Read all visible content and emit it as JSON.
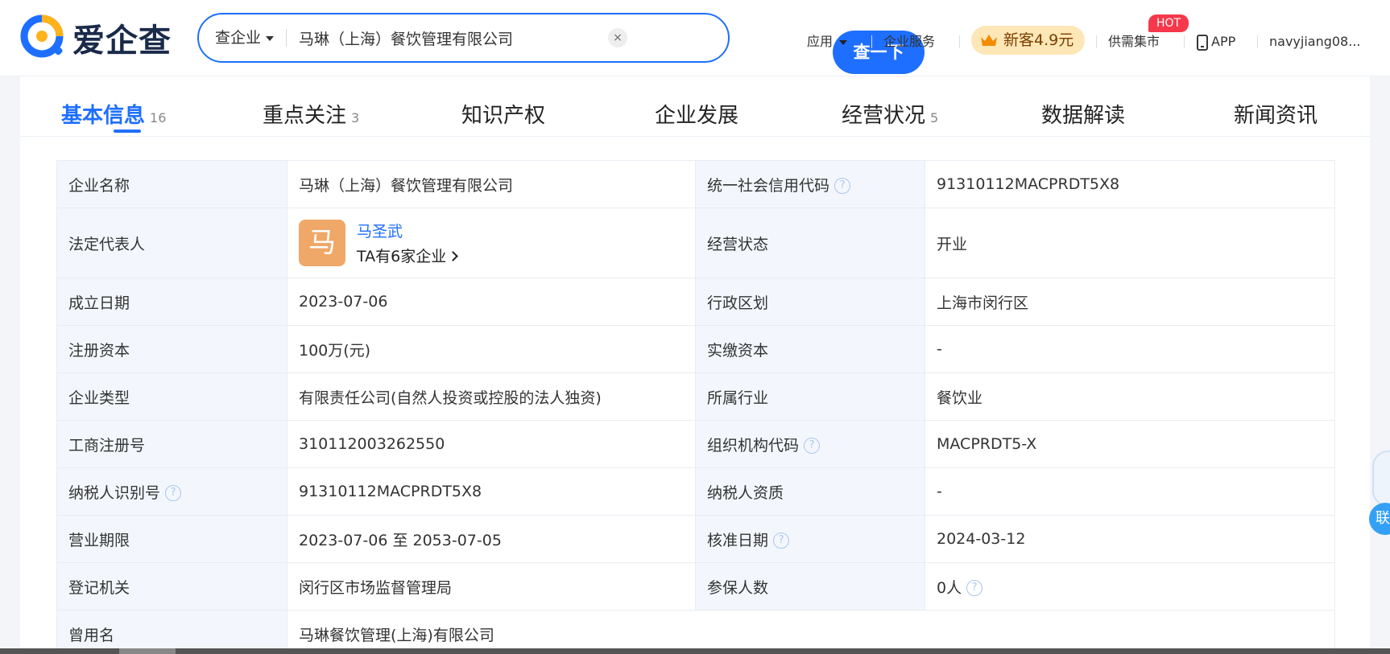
{
  "header": {
    "logo_text": "爱企查",
    "search": {
      "type_label": "查企业",
      "value": "马琳（上海）餐饮管理有限公司",
      "clear_symbol": "×",
      "button_label": "查一下"
    },
    "nav": {
      "apps": "应用",
      "enterprise_service": "企业服务",
      "new_customer_offer": "新客4.9元",
      "supply_demand": "供需集市",
      "hot_badge": "HOT",
      "app": "APP",
      "user": "navyjiang08..."
    }
  },
  "tabs": [
    {
      "label": "基本信息",
      "count": "16",
      "active": true
    },
    {
      "label": "重点关注",
      "count": "3"
    },
    {
      "label": "知识产权",
      "count": ""
    },
    {
      "label": "企业发展",
      "count": ""
    },
    {
      "label": "经营状况",
      "count": "5"
    },
    {
      "label": "数据解读",
      "count": ""
    },
    {
      "label": "新闻资讯",
      "count": ""
    }
  ],
  "info": {
    "company_name_label": "企业名称",
    "company_name": "马琳（上海）餐饮管理有限公司",
    "credit_code_label": "统一社会信用代码",
    "credit_code": "91310112MACPRDT5X8",
    "legal_rep_label": "法定代表人",
    "legal_rep_avatar": "马",
    "legal_rep_name": "马圣武",
    "legal_rep_companies": "TA有6家企业",
    "status_label": "经营状态",
    "status": "开业",
    "founded_label": "成立日期",
    "founded": "2023-07-06",
    "region_label": "行政区划",
    "region": "上海市闵行区",
    "reg_capital_label": "注册资本",
    "reg_capital": "100万(元)",
    "paid_capital_label": "实缴资本",
    "paid_capital": "-",
    "type_label": "企业类型",
    "type": "有限责任公司(自然人投资或控股的法人独资)",
    "industry_label": "所属行业",
    "industry": "餐饮业",
    "reg_no_label": "工商注册号",
    "reg_no": "310112003262550",
    "org_code_label": "组织机构代码",
    "org_code": "MACPRDT5-X",
    "taxpayer_id_label": "纳税人识别号",
    "taxpayer_id": "91310112MACPRDT5X8",
    "taxpayer_qual_label": "纳税人资质",
    "taxpayer_qual": "-",
    "term_label": "营业期限",
    "term": "2023-07-06 至 2053-07-05",
    "approval_date_label": "核准日期",
    "approval_date": "2024-03-12",
    "authority_label": "登记机关",
    "authority": "闵行区市场监督管理局",
    "insured_label": "参保人数",
    "insured": "0人",
    "former_name_label": "曾用名",
    "former_name": "马琳餐饮管理(上海)有限公司"
  },
  "help_symbol": "?",
  "float_widget_text": "联"
}
